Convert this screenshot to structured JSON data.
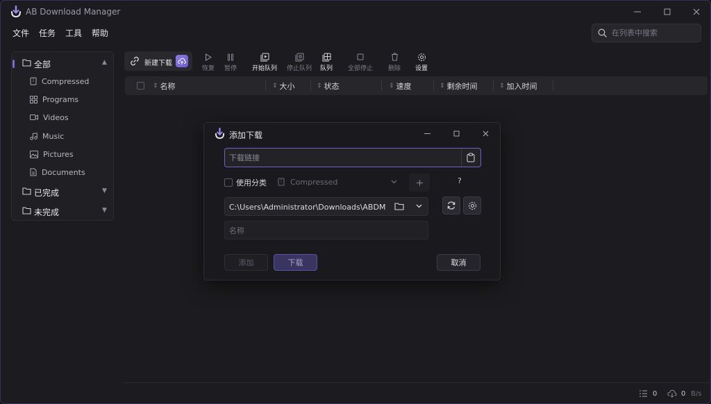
{
  "app": {
    "title": "AB Download Manager"
  },
  "menu": [
    "文件",
    "任务",
    "工具",
    "帮助"
  ],
  "search": {
    "placeholder": "在列表中搜索"
  },
  "sidebar": {
    "all": {
      "label": "全部"
    },
    "subs": [
      {
        "label": "Compressed",
        "icon": "archive-icon"
      },
      {
        "label": "Programs",
        "icon": "apps-icon"
      },
      {
        "label": "Videos",
        "icon": "video-icon"
      },
      {
        "label": "Music",
        "icon": "music-icon"
      },
      {
        "label": "Pictures",
        "icon": "picture-icon"
      },
      {
        "label": "Documents",
        "icon": "document-icon"
      }
    ],
    "finished": {
      "label": "已完成"
    },
    "unfinished": {
      "label": "未完成"
    }
  },
  "toolbar": {
    "new_download": "新建下载",
    "resume": "恢复",
    "pause": "暂停",
    "start_queue": "开始队列",
    "stop_queue": "停止队列",
    "queue": "队列",
    "stop_all": "全部停止",
    "delete": "删除",
    "settings": "设置"
  },
  "table": {
    "columns": [
      "名称",
      "大小",
      "状态",
      "速度",
      "剩余时间",
      "加入时间"
    ]
  },
  "statusbar": {
    "active_count": "0",
    "speed_value": "0",
    "speed_unit": "B/s"
  },
  "dialog": {
    "title": "添加下载",
    "url_placeholder": "下载链接",
    "use_category": "使用分类",
    "category_value": "Compressed",
    "help": "?",
    "path_value": "C:\\Users\\Administrator\\Downloads\\ABDM",
    "name_placeholder": "名称",
    "add": "添加",
    "download": "下载",
    "cancel": "取消"
  },
  "colors": {
    "accent": "#7c6bd6",
    "accent_light": "#8f7be8",
    "background": "#1c1c20"
  }
}
